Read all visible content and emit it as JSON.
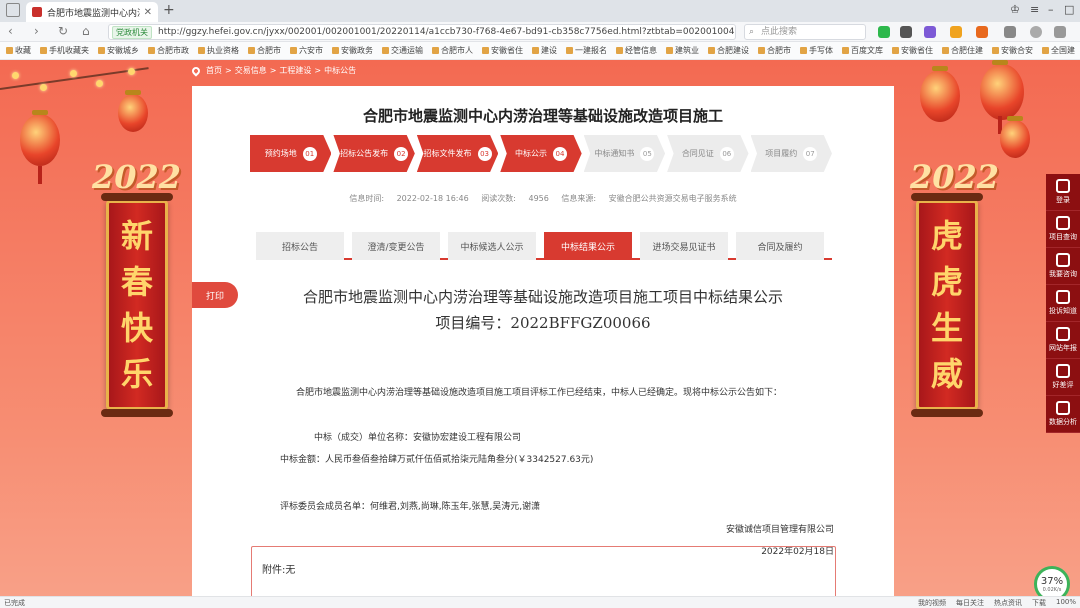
{
  "browser": {
    "tab_title": "合肥市地震监测中心内涝治理等",
    "url_badge": "党政机关",
    "url": "http://ggzy.hefei.gov.cn/jyxx/002001/002001001/20220114/a1ccb730-f768-4e67-bd91-cb358c7756ed.html?ztbtab=002001004",
    "search_placeholder": "点此搜索"
  },
  "bookmarks": [
    "收藏",
    "手机收藏夹",
    "安徽城乡",
    "合肥市政",
    "执业资格",
    "合肥市",
    "六安市",
    "安徽政务",
    "交通运输",
    "合肥市人",
    "安徽省住",
    "建设",
    "一建报名",
    "经管信息",
    "建筑业",
    "合肥建设",
    "合肥市",
    "手写体",
    "百度文库",
    "安徽省住",
    "合肥住建",
    "安徽合安",
    "全国建"
  ],
  "breadcrumb": [
    "首页",
    ">",
    "交易信息",
    ">",
    "工程建设",
    ">",
    "中标公告"
  ],
  "page": {
    "title": "合肥市地震监测中心内涝治理等基础设施改造项目施工",
    "steps": [
      {
        "label": "预约场地",
        "num": "01",
        "on": true
      },
      {
        "label": "招标公告发布",
        "num": "02",
        "on": true
      },
      {
        "label": "招标文件发布",
        "num": "03",
        "on": true
      },
      {
        "label": "中标公示",
        "num": "04",
        "on": true
      },
      {
        "label": "中标通知书",
        "num": "05",
        "on": false
      },
      {
        "label": "合同见证",
        "num": "06",
        "on": false
      },
      {
        "label": "项目履约",
        "num": "07",
        "on": false
      }
    ],
    "meta": {
      "time_label": "信息时间:",
      "time": "2022-02-18 16:46",
      "views_label": "阅读次数:",
      "views": "4956",
      "source_label": "信息来源:",
      "source": "安徽合肥公共资源交易电子服务系统"
    },
    "tabs": [
      "招标公告",
      "澄清/变更公告",
      "中标候选人公示",
      "中标结果公示",
      "进场交易见证书",
      "合同及履约"
    ],
    "active_tab": 3,
    "print_label": "打印",
    "article_title": "合肥市地震监测中心内涝治理等基础设施改造项目施工项目中标结果公示",
    "project_no": "项目编号：2022BFFGZ00066",
    "para1": "合肥市地震监测中心内涝治理等基础设施改造项目施工项目评标工作已经结束，中标人已经确定。现将中标公示公告如下：",
    "winner": "中标（成交）单位名称：安徽协宏建设工程有限公司",
    "amount": "中标金额：人民币叁佰叁拾肆万贰仟伍佰贰拾柒元陆角叁分(￥3342527.63元)",
    "committee": "评标委员会成员名单：何维君,刘燕,尚琳,陈玉年,张慧,吴涛元,谢潇",
    "agency": "安徽诚信项目管理有限公司",
    "date": "2022年02月18日",
    "attachment": "附件:无"
  },
  "decor": {
    "year_left": "2022",
    "year_right": "2022",
    "banner_left": [
      "新",
      "春",
      "快",
      "乐"
    ],
    "banner_right": [
      "虎",
      "虎",
      "生",
      "威"
    ]
  },
  "right_sidebar": [
    "登录",
    "项目查询",
    "我要咨询",
    "投诉知道",
    "网站年报",
    "好差评",
    "数据分析"
  ],
  "speed": {
    "percent": "37%",
    "rate": "0.02K/s"
  },
  "status": {
    "left": "已完成",
    "right": [
      "我的视频",
      "每日关注",
      "热点资讯",
      "下载",
      "100%"
    ]
  }
}
